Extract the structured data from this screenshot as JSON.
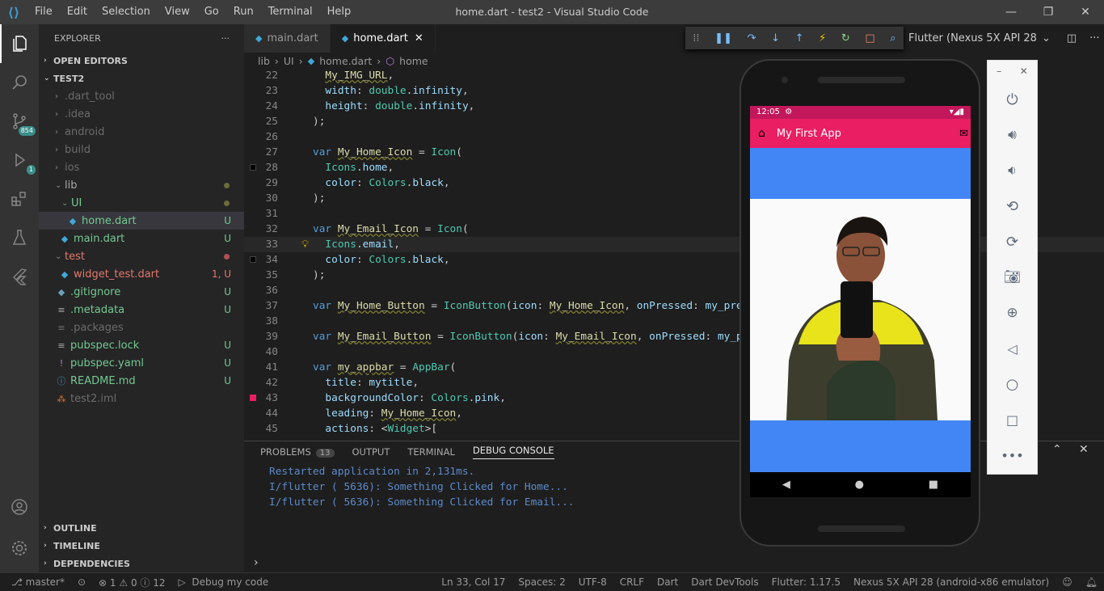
{
  "menu": [
    "File",
    "Edit",
    "Selection",
    "View",
    "Go",
    "Run",
    "Terminal",
    "Help"
  ],
  "window_title": "home.dart - test2 - Visual Studio Code",
  "explorer": {
    "title": "EXPLORER",
    "open_editors": "OPEN EDITORS",
    "project": "TEST2",
    "outline": "OUTLINE",
    "timeline": "TIMELINE",
    "dependencies": "DEPENDENCIES"
  },
  "tree": [
    {
      "name": ".dart_tool",
      "status": ""
    },
    {
      "name": ".idea",
      "status": ""
    },
    {
      "name": "android",
      "status": ""
    },
    {
      "name": "build",
      "status": ""
    },
    {
      "name": "ios",
      "status": ""
    },
    {
      "name": "lib",
      "status": ""
    },
    {
      "name": "UI",
      "status": ""
    },
    {
      "name": "home.dart",
      "status": "U"
    },
    {
      "name": "main.dart",
      "status": "U"
    },
    {
      "name": "test",
      "status": ""
    },
    {
      "name": "widget_test.dart",
      "status": "1, U"
    },
    {
      "name": ".gitignore",
      "status": "U"
    },
    {
      "name": ".metadata",
      "status": "U"
    },
    {
      "name": ".packages",
      "status": ""
    },
    {
      "name": "pubspec.lock",
      "status": "U"
    },
    {
      "name": "pubspec.yaml",
      "status": "U"
    },
    {
      "name": "README.md",
      "status": "U"
    },
    {
      "name": "test2.iml",
      "status": ""
    }
  ],
  "activity_badges": {
    "scm": "854",
    "run": "1"
  },
  "tabs": [
    "main.dart",
    "home.dart"
  ],
  "breadcrumb": [
    "lib",
    "UI",
    "home.dart",
    "home"
  ],
  "device": "Flutter (Nexus 5X API 28",
  "code_lines": [
    {
      "n": "22",
      "t": "  My_IMG_URL,"
    },
    {
      "n": "23",
      "t": "  width: double.infinity,"
    },
    {
      "n": "24",
      "t": "  height: double.infinity,"
    },
    {
      "n": "25",
      "t": ");"
    },
    {
      "n": "26",
      "t": ""
    },
    {
      "n": "27",
      "t": "var My_Home_Icon = Icon("
    },
    {
      "n": "28",
      "t": "  Icons.home,"
    },
    {
      "n": "29",
      "t": "  color: Colors.black,"
    },
    {
      "n": "30",
      "t": ");"
    },
    {
      "n": "31",
      "t": ""
    },
    {
      "n": "32",
      "t": "var My_Email_Icon = Icon("
    },
    {
      "n": "33",
      "t": "  Icons.email,"
    },
    {
      "n": "34",
      "t": "  color: Colors.black,"
    },
    {
      "n": "35",
      "t": ");"
    },
    {
      "n": "36",
      "t": ""
    },
    {
      "n": "37",
      "t": "var My_Home_Button = IconButton(icon: My_Home_Icon, onPressed: my_pre"
    },
    {
      "n": "38",
      "t": ""
    },
    {
      "n": "39",
      "t": "var My_Email_Button = IconButton(icon: My_Email_Icon, onPressed: my_p"
    },
    {
      "n": "40",
      "t": ""
    },
    {
      "n": "41",
      "t": "var my_appbar = AppBar("
    },
    {
      "n": "42",
      "t": "  title: mytitle,"
    },
    {
      "n": "43",
      "t": "  backgroundColor: Colors.pink,"
    },
    {
      "n": "44",
      "t": "  leading: My_Home_Icon,"
    },
    {
      "n": "45",
      "t": "  actions: <Widget>["
    }
  ],
  "panel": {
    "tabs": [
      "PROBLEMS",
      "OUTPUT",
      "TERMINAL",
      "DEBUG CONSOLE"
    ],
    "problems_count": "13"
  },
  "console": [
    "Restarted application in 2,131ms.",
    "I/flutter ( 5636): Something Clicked for Home...",
    "I/flutter ( 5636): Something Clicked for Email..."
  ],
  "status": {
    "branch": "master*",
    "errors": "1",
    "warnings": "0",
    "infos": "12",
    "debug": "Debug my code",
    "position": "Ln 33, Col 17",
    "spaces": "Spaces: 2",
    "encoding": "UTF-8",
    "eol": "CRLF",
    "lang": "Dart",
    "devtools": "Dart DevTools",
    "flutter": "Flutter: 1.17.5",
    "device": "Nexus 5X API 28 (android-x86 emulator)"
  },
  "phone": {
    "time": "12:05",
    "app_title": "My First App"
  }
}
